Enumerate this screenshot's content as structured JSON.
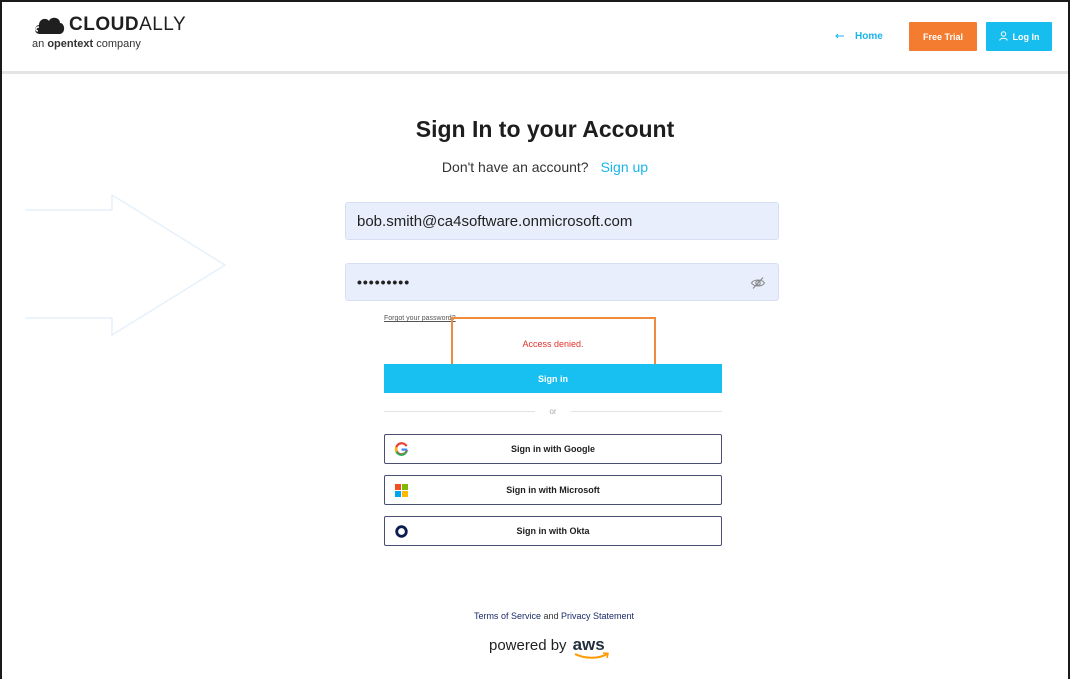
{
  "header": {
    "logo_name": "CLOUD",
    "logo_name_thin": "ALLY",
    "logo_tag_prefix": "an",
    "logo_tag_brand": "opentext",
    "logo_tag_suffix": "company",
    "home_label": "Home",
    "free_trial_label": "Free Trial",
    "login_label": "Log In"
  },
  "form": {
    "title": "Sign In to your Account",
    "signup_prompt": "Don't have an account?",
    "signup_link": "Sign up",
    "email_value": "bob.smith@ca4software.onmicrosoft.com",
    "password_value": "•••••••••",
    "forgot_label": "Forgot your password?",
    "error_message": "Access denied.",
    "signin_label": "Sign in",
    "divider_label": "or"
  },
  "sso": {
    "google_label": "Sign in with Google",
    "microsoft_label": "Sign in with Microsoft",
    "okta_label": "Sign in with Okta"
  },
  "footer": {
    "terms_label": "Terms of Service",
    "and_label": "and",
    "privacy_label": "Privacy Statement",
    "powered_label": "powered by",
    "aws_label": "aws"
  },
  "icons": {
    "home": "arrow-left-icon",
    "login": "user-icon",
    "eye": "eye-off-icon",
    "google": "google-icon",
    "microsoft": "microsoft-icon",
    "okta": "okta-icon"
  },
  "colors": {
    "accent_blue": "#18bdf0",
    "trial_orange": "#f47c30",
    "error_red": "#e0322f",
    "highlight_orange": "#f08a3c",
    "input_bg": "#e8eefb"
  }
}
